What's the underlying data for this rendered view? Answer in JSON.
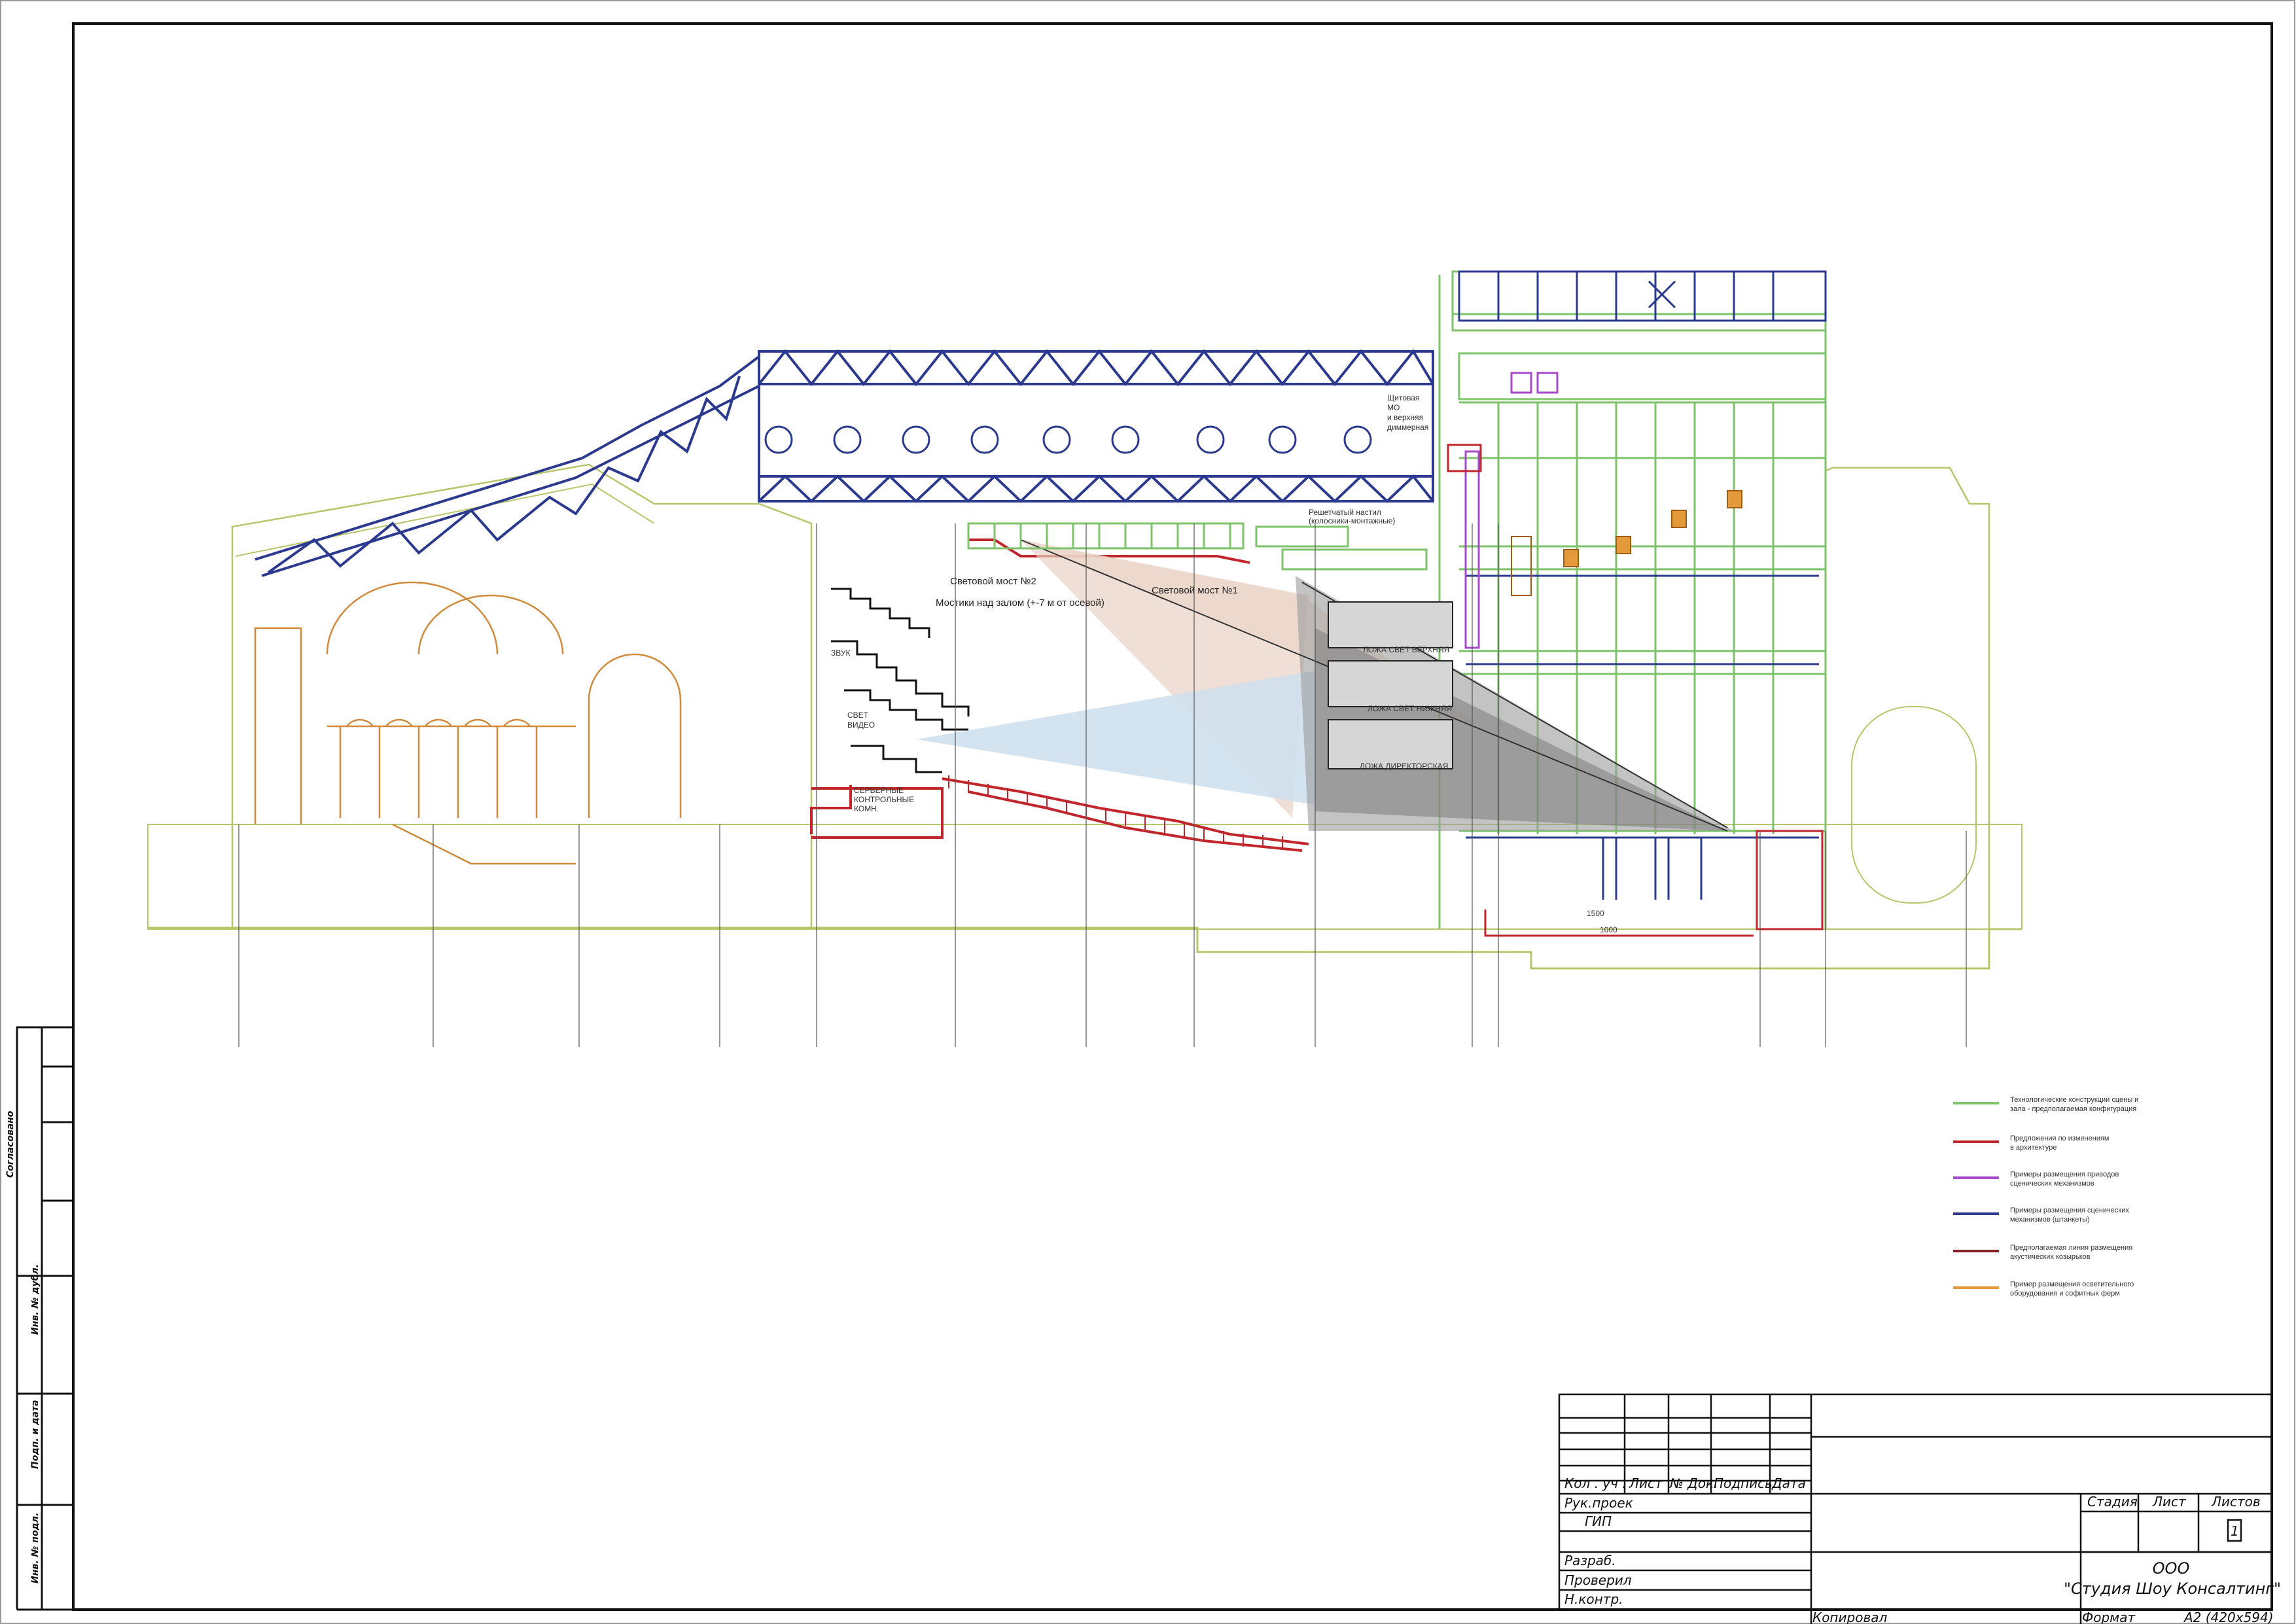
{
  "drawing": {
    "labels": {
      "bridge_2": "Световой мост №2",
      "walkways": "Мостики над залом  (+-7 м от осевой)",
      "bridge_1": "Световой мост №1",
      "sound": "ЗВУК",
      "light": "СВЕТ",
      "video": "ВИДЕО",
      "control_booths": [
        "СЕРВЕРНЫЕ",
        "КОНТРОЛЬНЫЕ",
        "КОМН."
      ],
      "switchboard": [
        "Щитовая",
        "МО",
        "и верхняя",
        "диммерная"
      ],
      "grid_deck": [
        "Решетчатый настил",
        "(колосники-монтажные)"
      ],
      "box_light_upper": "ЛОЖА СВЕТ ВЕРХНЯЯ",
      "box_light_middle": "ЛОЖА СВЕТ НИЖНЯЯ",
      "box_director": "ЛОЖА ДИРЕКТОРСКАЯ",
      "dim_1": "1500",
      "dim_2": "1000"
    }
  },
  "legend": {
    "items": [
      {
        "color": "#7cc36a",
        "text": [
          "Технологические конструкции сцены и",
          "зала - предполагаемая конфигурация"
        ]
      },
      {
        "color": "#c0262b",
        "text": [
          "Предложения по изменениям",
          "в архитектуре"
        ]
      },
      {
        "color": "#a64ac9",
        "text": [
          "Примеры размещения приводов",
          "сценических механизмов"
        ]
      },
      {
        "color": "#2b3a8f",
        "text": [
          "Примеры размещения сценических",
          "механизмов (штанкеты)"
        ]
      },
      {
        "color": "#8c1e2c",
        "text": [
          "Предполагаемая линия размещения",
          "акустических козырьков"
        ]
      },
      {
        "color": "#e39a3a",
        "text": [
          "Пример размещения осветительного",
          "оборудования и софитных ферм"
        ]
      }
    ]
  },
  "side_strip": {
    "items": [
      "Согласовано",
      "Инв. № дубл.",
      "Подп. и дата",
      "Инв. № подл."
    ]
  },
  "title_block": {
    "col_headers": [
      "Кол . уч .",
      "Лист",
      "№ Док.",
      "Подпись",
      "Дата"
    ],
    "roles": [
      "Рук.проек",
      "ГИП",
      "",
      "Разраб.",
      "Проверил",
      "Н.контр."
    ],
    "stage_headers": [
      "Стадия",
      "Лист",
      "Листов"
    ],
    "sheets_count": "1",
    "company": [
      "ООО",
      "\"Студия Шоу Консалтинг\""
    ],
    "copied": "Копировал",
    "format_label": "Формат",
    "format_value": "А2 (420х594)"
  }
}
